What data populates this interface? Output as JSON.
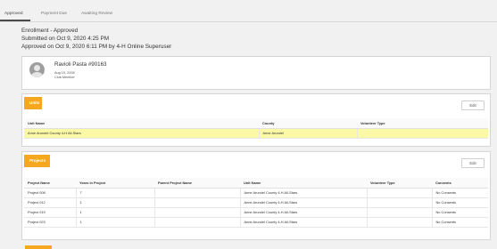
{
  "tabs": [
    {
      "label": "Approved",
      "active": true
    },
    {
      "label": "Payment Due",
      "active": false
    },
    {
      "label": "Awaiting Review",
      "active": false
    }
  ],
  "enrollment": {
    "status": "Enrollment - Approved",
    "submitted": "Submitted on Oct 9, 2020 4:25 PM",
    "approved": "Approved on Oct 9, 2020 6:11 PM by 4-H Online Superuser"
  },
  "member": {
    "name": "Ravioli Pasta #90163",
    "birthdate": "Aug 15, 2008",
    "role": "Club Member",
    "avatar_icon": "user-avatar-icon"
  },
  "units": {
    "title": "Units",
    "edit_label": "Edit",
    "columns": [
      "Unit Name",
      "County",
      "Volunteer Type"
    ],
    "rows": [
      [
        "Anne Arundel County 4-H All-Stars",
        "Anne Arundel",
        ""
      ]
    ],
    "highlight_color": "#fbf8a6"
  },
  "projects": {
    "title": "Projects",
    "edit_label": "Edit",
    "columns": [
      "Project Name",
      "Years in Project",
      "Parent Project Name",
      "Unit Name",
      "Volunteer Type",
      "Consents"
    ],
    "rows": [
      [
        "Project 008",
        "7",
        "",
        "Anne Arundel County 4-H All-Stars",
        "",
        "No Consents"
      ],
      [
        "Project 012",
        "1",
        "",
        "Anne Arundel County 4-H All-Stars",
        "",
        "No Consents"
      ],
      [
        "Project 019",
        "1",
        "",
        "Anne Arundel County 4-H All-Stars",
        "",
        "No Consents"
      ],
      [
        "Project 023",
        "1",
        "",
        "Anne Arundel County 4-H All-Stars",
        "",
        "No Consents"
      ]
    ]
  },
  "colors": {
    "accent": "#f4a71f",
    "background": "#f1f1f1"
  }
}
